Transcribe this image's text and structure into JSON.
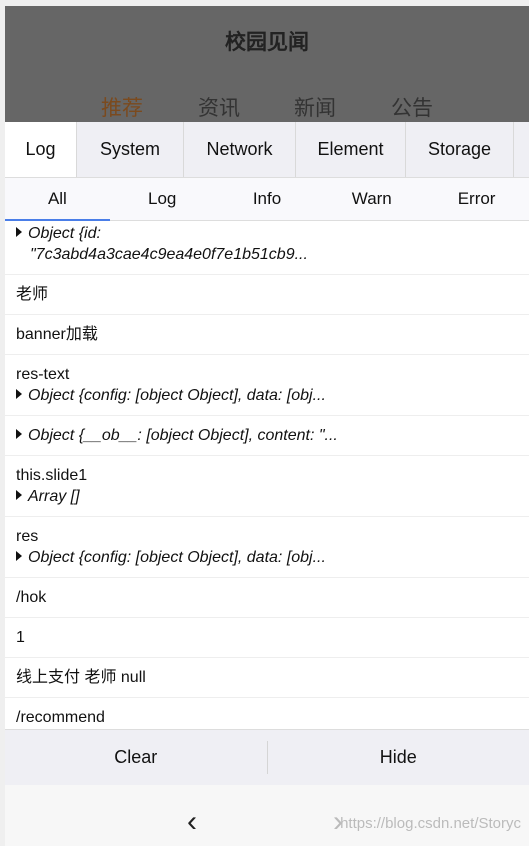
{
  "header": {
    "title": "校园见闻",
    "categories": [
      "推荐",
      "资讯",
      "新闻",
      "公告"
    ],
    "active_category_color": "#7b4a1e"
  },
  "tabs": [
    "Log",
    "System",
    "Network",
    "Element",
    "Storage"
  ],
  "filters": [
    "All",
    "Log",
    "Info",
    "Warn",
    "Error"
  ],
  "logs": [
    {
      "obj1": "Object {id:",
      "obj2": "\"7c3abd4a3cae4c9ea4e0f7e1b51cb9..."
    },
    {
      "text": "老师"
    },
    {
      "text": "banner加载"
    },
    {
      "text": "res-text",
      "obj": "Object {config: [object Object], data: [obj..."
    },
    {
      "obj": "Object {__ob__: [object Object], content: \"..."
    },
    {
      "text": "this.slide1",
      "obj": "Array []"
    },
    {
      "text": "res",
      "obj": "Object {config: [object Object], data: [obj..."
    },
    {
      "text": "/hok"
    },
    {
      "text": "1"
    },
    {
      "text": "线上支付 老师 null"
    },
    {
      "text": "/recommend"
    }
  ],
  "bottom": {
    "clear": "Clear",
    "hide": "Hide"
  },
  "nav": {
    "back_icon": "chevron-left-icon",
    "forward_icon": "chevron-right-icon"
  },
  "watermark": "https://blog.csdn.net/Storyc",
  "accent": "#4a7ee8"
}
